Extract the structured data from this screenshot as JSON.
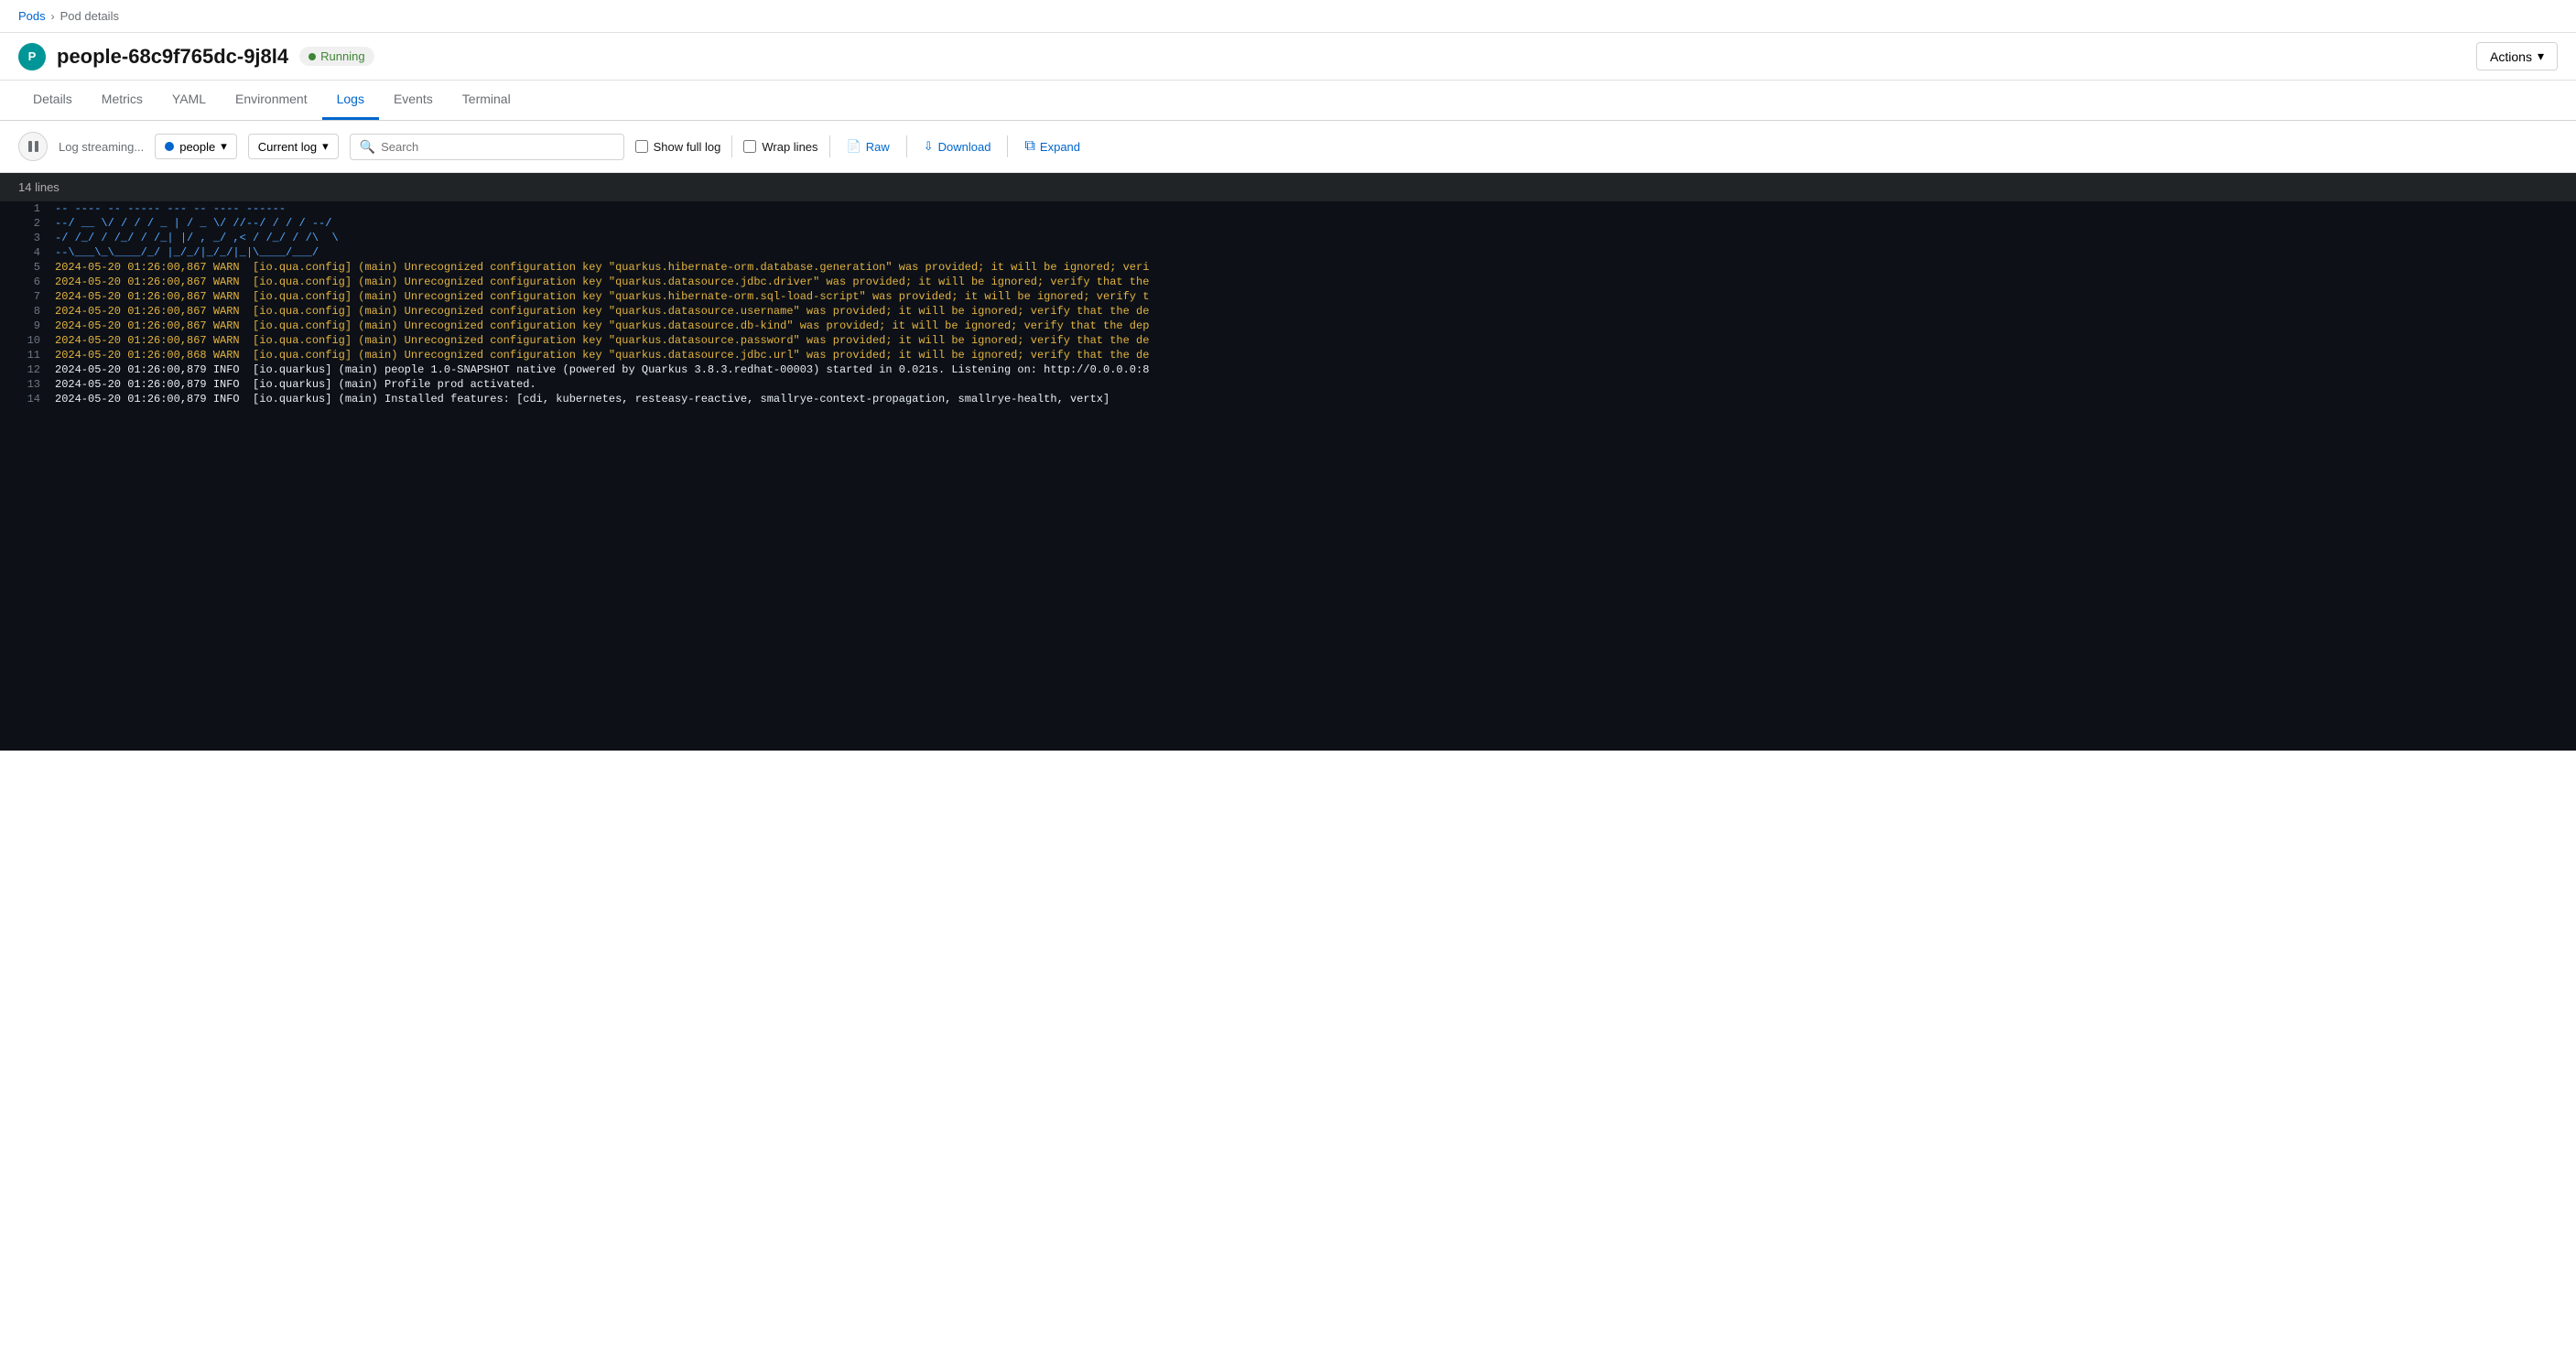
{
  "breadcrumb": {
    "parent": "Pods",
    "separator": "›",
    "current": "Pod details"
  },
  "header": {
    "pod_icon_letter": "P",
    "pod_name": "people-68c9f765dc-9j8l4",
    "status_label": "Running",
    "actions_label": "Actions"
  },
  "tabs": [
    {
      "id": "details",
      "label": "Details",
      "active": false
    },
    {
      "id": "metrics",
      "label": "Metrics",
      "active": false
    },
    {
      "id": "yaml",
      "label": "YAML",
      "active": false
    },
    {
      "id": "environment",
      "label": "Environment",
      "active": false
    },
    {
      "id": "logs",
      "label": "Logs",
      "active": true
    },
    {
      "id": "events",
      "label": "Events",
      "active": false
    },
    {
      "id": "terminal",
      "label": "Terminal",
      "active": false
    }
  ],
  "toolbar": {
    "streaming_label": "Log streaming...",
    "container_dropdown": {
      "label": "people",
      "value": "people"
    },
    "log_dropdown": {
      "label": "Current log",
      "value": "current"
    },
    "search_placeholder": "Search",
    "show_full_log_label": "Show full log",
    "wrap_lines_label": "Wrap lines",
    "raw_label": "Raw",
    "download_label": "Download",
    "expand_label": "Expand"
  },
  "log_output": {
    "lines_count": "14 lines",
    "lines": [
      {
        "num": 1,
        "content": "-- ---- -- ----- --- -- ---- ------",
        "type": "ascii"
      },
      {
        "num": 2,
        "content": "--/ __ \\/ / / / _ | / _ \\/ //--/ / / / --/",
        "type": "ascii"
      },
      {
        "num": 3,
        "content": "-/ /_/ / /_/ / /_| |/ , _/ ,< / /_/ / /\\  \\",
        "type": "ascii"
      },
      {
        "num": 4,
        "content": "--\\___\\_\\____/_/ |_/_/|_/_/|_|\\____/___/",
        "type": "ascii"
      },
      {
        "num": 5,
        "content": "2024-05-20 01:26:00,867 WARN  [io.qua.config] (main) Unrecognized configuration key \"quarkus.hibernate-orm.database.generation\" was provided; it will be ignored; veri",
        "type": "warn"
      },
      {
        "num": 6,
        "content": "2024-05-20 01:26:00,867 WARN  [io.qua.config] (main) Unrecognized configuration key \"quarkus.datasource.jdbc.driver\" was provided; it will be ignored; verify that the",
        "type": "warn"
      },
      {
        "num": 7,
        "content": "2024-05-20 01:26:00,867 WARN  [io.qua.config] (main) Unrecognized configuration key \"quarkus.hibernate-orm.sql-load-script\" was provided; it will be ignored; verify t",
        "type": "warn"
      },
      {
        "num": 8,
        "content": "2024-05-20 01:26:00,867 WARN  [io.qua.config] (main) Unrecognized configuration key \"quarkus.datasource.username\" was provided; it will be ignored; verify that the de",
        "type": "warn"
      },
      {
        "num": 9,
        "content": "2024-05-20 01:26:00,867 WARN  [io.qua.config] (main) Unrecognized configuration key \"quarkus.datasource.db-kind\" was provided; it will be ignored; verify that the dep",
        "type": "warn"
      },
      {
        "num": 10,
        "content": "2024-05-20 01:26:00,867 WARN  [io.qua.config] (main) Unrecognized configuration key \"quarkus.datasource.password\" was provided; it will be ignored; verify that the de",
        "type": "warn"
      },
      {
        "num": 11,
        "content": "2024-05-20 01:26:00,868 WARN  [io.qua.config] (main) Unrecognized configuration key \"quarkus.datasource.jdbc.url\" was provided; it will be ignored; verify that the de",
        "type": "warn"
      },
      {
        "num": 12,
        "content": "2024-05-20 01:26:00,879 INFO  [io.quarkus] (main) people 1.0-SNAPSHOT native (powered by Quarkus 3.8.3.redhat-00003) started in 0.021s. Listening on: http://0.0.0.0:8",
        "type": "info"
      },
      {
        "num": 13,
        "content": "2024-05-20 01:26:00,879 INFO  [io.quarkus] (main) Profile prod activated.",
        "type": "info"
      },
      {
        "num": 14,
        "content": "2024-05-20 01:26:00,879 INFO  [io.quarkus] (main) Installed features: [cdi, kubernetes, resteasy-reactive, smallrye-context-propagation, smallrye-health, vertx]",
        "type": "info"
      }
    ]
  }
}
